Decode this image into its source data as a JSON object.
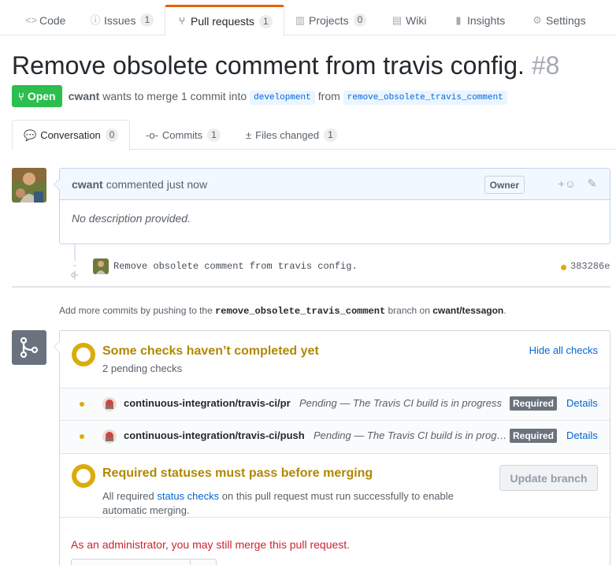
{
  "repo_nav": {
    "tabs": [
      {
        "label": "Code",
        "icon": "code-icon"
      },
      {
        "label": "Issues",
        "icon": "issue-icon",
        "count": "1"
      },
      {
        "label": "Pull requests",
        "icon": "pull-request-icon",
        "count": "1",
        "selected": true
      },
      {
        "label": "Projects",
        "icon": "project-icon",
        "count": "0"
      },
      {
        "label": "Wiki",
        "icon": "book-icon"
      },
      {
        "label": "Insights",
        "icon": "graph-icon"
      },
      {
        "label": "Settings",
        "icon": "gear-icon"
      }
    ]
  },
  "pr": {
    "title": "Remove obsolete comment from travis config.",
    "number": "#8",
    "state": "Open",
    "author": "cwant",
    "merge_text": "wants to merge 1 commit into",
    "base_branch": "development",
    "from_text": "from",
    "head_branch": "remove_obsolete_travis_comment"
  },
  "pr_tabs": [
    {
      "label": "Conversation",
      "icon": "comment-discussion-icon",
      "count": "0",
      "selected": true
    },
    {
      "label": "Commits",
      "icon": "git-commit-icon",
      "count": "1"
    },
    {
      "label": "Files changed",
      "icon": "diff-icon",
      "count": "1"
    }
  ],
  "comment": {
    "author": "cwant",
    "action": "commented just now",
    "role": "Owner",
    "reaction_label": "+",
    "body": "No description provided."
  },
  "commit": {
    "message": "Remove obsolete comment from travis config.",
    "sha": "383286e"
  },
  "push_hint": {
    "prefix": "Add more commits by pushing to the",
    "branch": "remove_obsolete_travis_comment",
    "middle": "branch on",
    "repo": "cwant/tessagon",
    "suffix": "."
  },
  "checks": {
    "title": "Some checks haven’t completed yet",
    "subtitle": "2 pending checks",
    "hide_label": "Hide all checks",
    "items": [
      {
        "name": "continuous-integration/travis-ci/pr",
        "description": "Pending — The Travis CI build is in progress",
        "required": "Required",
        "details": "Details"
      },
      {
        "name": "continuous-integration/travis-ci/push",
        "description": "Pending — The Travis CI build is in progress",
        "required": "Required",
        "details": "Details"
      }
    ]
  },
  "required_status": {
    "title": "Required statuses must pass before merging",
    "desc_prefix": "All required",
    "desc_link": "status checks",
    "desc_suffix": "on this pull request must run successfully to enable automatic merging.",
    "update_button": "Update branch"
  },
  "admin": {
    "message": "As an administrator, you may still merge this pull request."
  },
  "colors": {
    "open_green": "#2cbe4e",
    "pending_yellow": "#dbab09",
    "accent_orange": "#e36209",
    "link_blue": "#0366d6",
    "danger_red": "#cb2431"
  }
}
